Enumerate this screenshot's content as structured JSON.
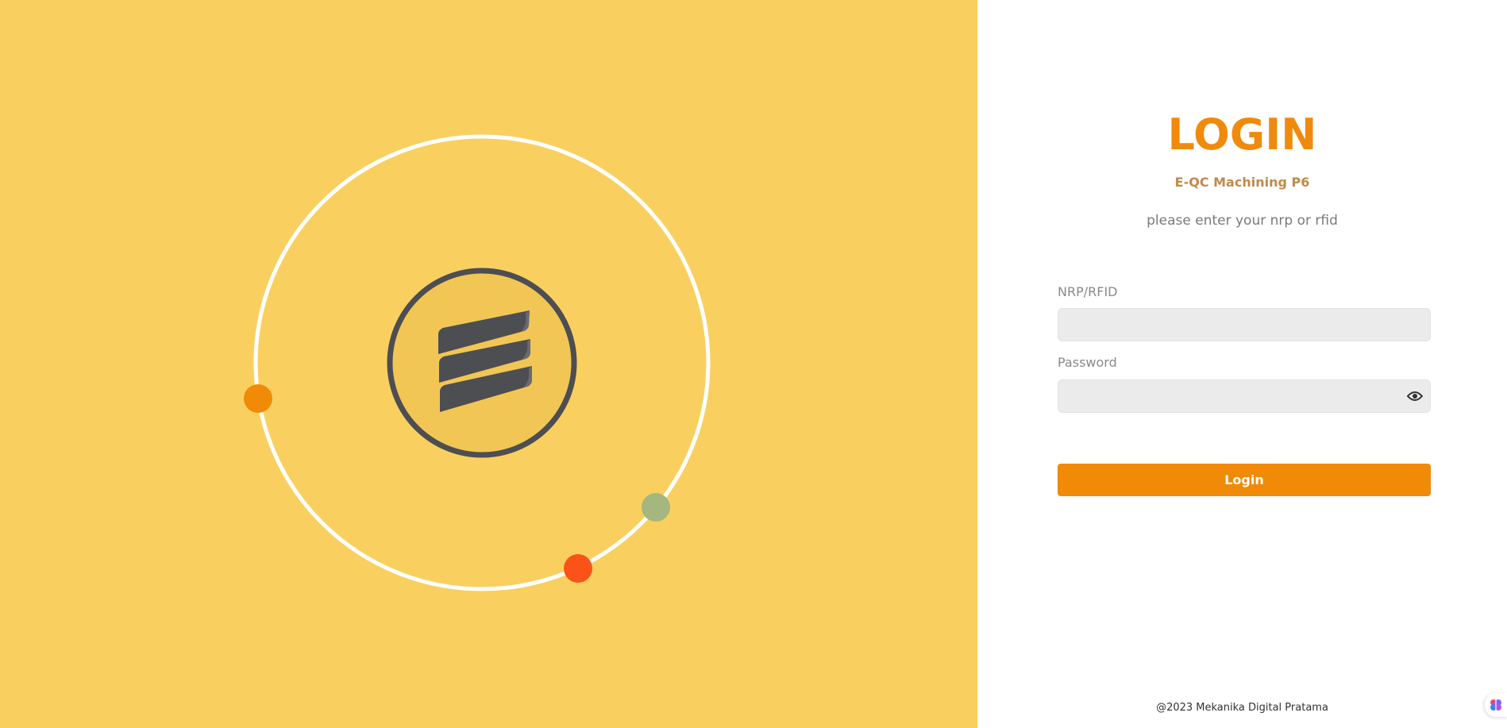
{
  "colors": {
    "left_background": "#F9D060",
    "accent": "#F08A07",
    "title": "#F08A0C",
    "subtitle": "#C08A4C",
    "input_background": "#EBEBEB",
    "logo_dark": "#4D4E52",
    "orbit_dot_orange": "#F08A07",
    "orbit_dot_green": "#A3B77F",
    "orbit_dot_red": "#FA5217"
  },
  "brand": {
    "logo_icon": "company-logo"
  },
  "login": {
    "title": "LOGIN",
    "app_name": "E-QC Machining P6",
    "instruction": "please enter your nrp or rfid",
    "nrp_label": "NRP/RFID",
    "nrp_value": "",
    "nrp_placeholder": "",
    "password_label": "Password",
    "password_value": "",
    "password_placeholder": "",
    "password_toggle_icon": "eye-icon",
    "submit_label": "Login"
  },
  "footer": {
    "copyright": "@2023 Mekanika Digital Pratama"
  },
  "extension": {
    "icon": "extension-brain-icon"
  }
}
